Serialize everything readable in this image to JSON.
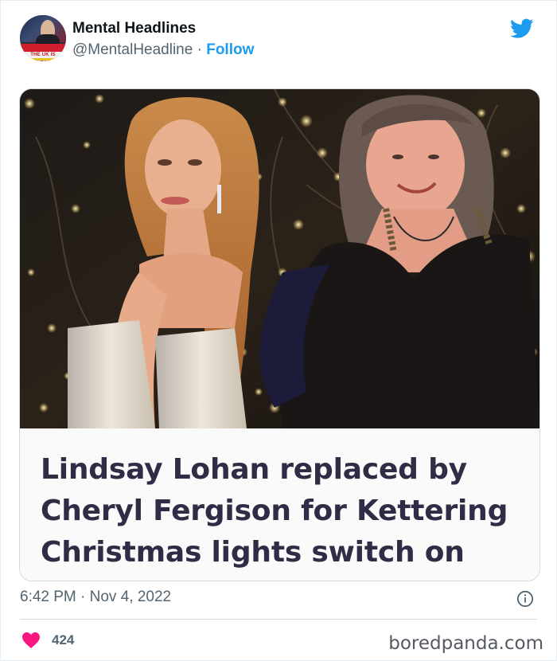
{
  "tweet": {
    "author_name": "Mental Headlines",
    "handle": "@MentalHeadline",
    "separator": "·",
    "follow_label": "Follow",
    "avatar_text": "THE UK IS MENTAL",
    "headline_lines": [
      "Lindsay Lohan replaced by",
      "Cheryl Fergison for Kettering",
      "Christmas lights switch on"
    ],
    "timestamp": "6:42 PM · Nov 4, 2022",
    "likes_count": "424"
  },
  "watermark": "boredpanda.com",
  "icons": {
    "brand": "twitter-bird-icon",
    "info": "info-icon",
    "like": "heart-icon"
  },
  "colors": {
    "twitter_blue": "#1d9bf0",
    "heart": "#f91880",
    "headline_text": "#2e2d45",
    "secondary_text": "#536471"
  }
}
